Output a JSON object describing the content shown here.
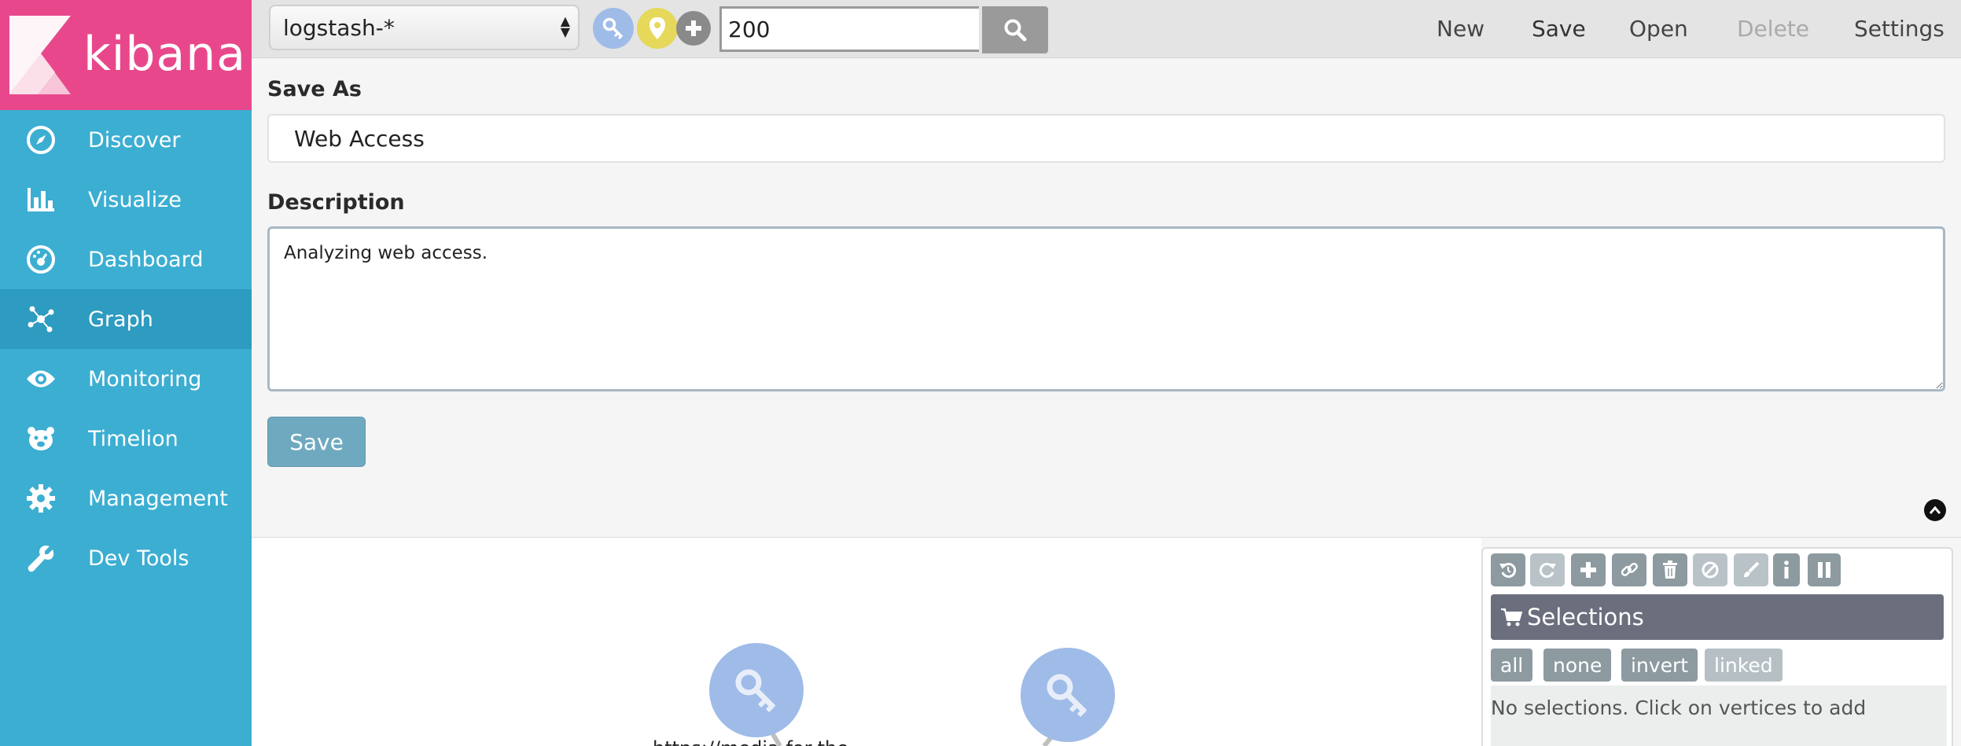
{
  "app": {
    "name": "kibana"
  },
  "sidebar": {
    "items": [
      {
        "label": "Discover",
        "icon": "compass-icon"
      },
      {
        "label": "Visualize",
        "icon": "bar-chart-icon"
      },
      {
        "label": "Dashboard",
        "icon": "dashboard-gauge-icon"
      },
      {
        "label": "Graph",
        "icon": "graph-network-icon",
        "active": true
      },
      {
        "label": "Monitoring",
        "icon": "eye-icon"
      },
      {
        "label": "Timelion",
        "icon": "timelion-bear-icon"
      },
      {
        "label": "Management",
        "icon": "gear-icon"
      },
      {
        "label": "Dev Tools",
        "icon": "wrench-icon"
      }
    ]
  },
  "toolbar": {
    "index_pattern": "logstash-*",
    "search_value": "200",
    "links": {
      "new": "New",
      "save": "Save",
      "open": "Open",
      "delete": "Delete",
      "settings": "Settings"
    }
  },
  "save_form": {
    "save_as_label": "Save As",
    "save_as_value": "Web Access",
    "description_label": "Description",
    "description_value": "Analyzing web access.",
    "submit_label": "Save"
  },
  "graph": {
    "vertices": [
      {
        "icon": "key-icon",
        "label": "https://media-for-the"
      },
      {
        "icon": "key-icon",
        "label": ""
      }
    ]
  },
  "selections_panel": {
    "title": "Selections",
    "buttons": {
      "all": "all",
      "none": "none",
      "invert": "invert",
      "linked": "linked"
    },
    "empty_message": "No selections. Click on vertices to add"
  },
  "colors": {
    "logo_bg": "#e8488b",
    "sidebar_bg": "#3caed2",
    "sidebar_active": "#2e9bc1",
    "vertex": "#9fbbe8"
  }
}
